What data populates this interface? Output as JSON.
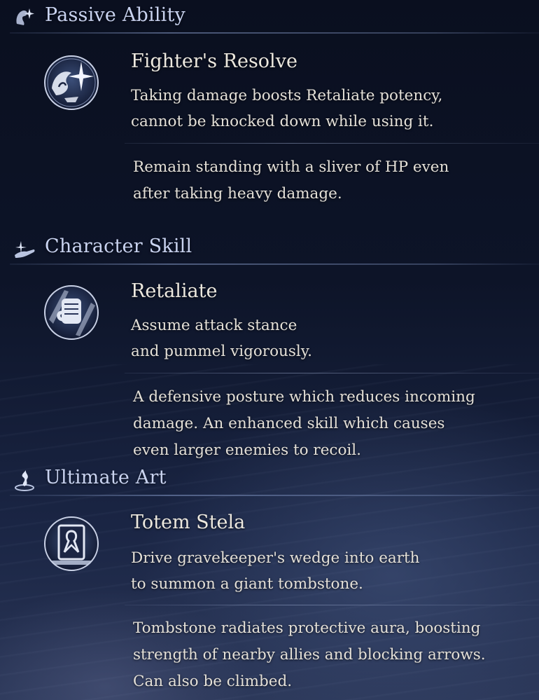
{
  "sections": [
    {
      "title": "Passive Ability",
      "header_icon": "spirit-sparkle-icon",
      "skill_icon": "fighters-resolve-icon",
      "skill_name": "Fighter's Resolve",
      "desc_lines": [
        "Taking damage boosts Retaliate potency,",
        "cannot be knocked down while using it."
      ],
      "detail_lines": [
        "Remain standing with a sliver of HP even",
        "after taking heavy damage."
      ]
    },
    {
      "title": "Character Skill",
      "header_icon": "hand-skill-icon",
      "skill_icon": "retaliate-fist-icon",
      "skill_name": "Retaliate",
      "desc_lines": [
        "Assume attack stance",
        "and pummel vigorously."
      ],
      "detail_lines": [
        "A defensive posture which reduces incoming",
        "damage. An enhanced skill which causes",
        "even larger enemies to recoil."
      ]
    },
    {
      "title": "Ultimate Art",
      "header_icon": "swirl-flame-icon",
      "skill_icon": "totem-stela-icon",
      "skill_name": "Totem Stela",
      "desc_lines": [
        "Drive gravekeeper's wedge into earth",
        "to summon a giant tombstone."
      ],
      "detail_lines": [
        "Tombstone radiates protective aura, boosting",
        "strength of nearby allies and blocking arrows.",
        "Can also be climbed."
      ]
    }
  ]
}
